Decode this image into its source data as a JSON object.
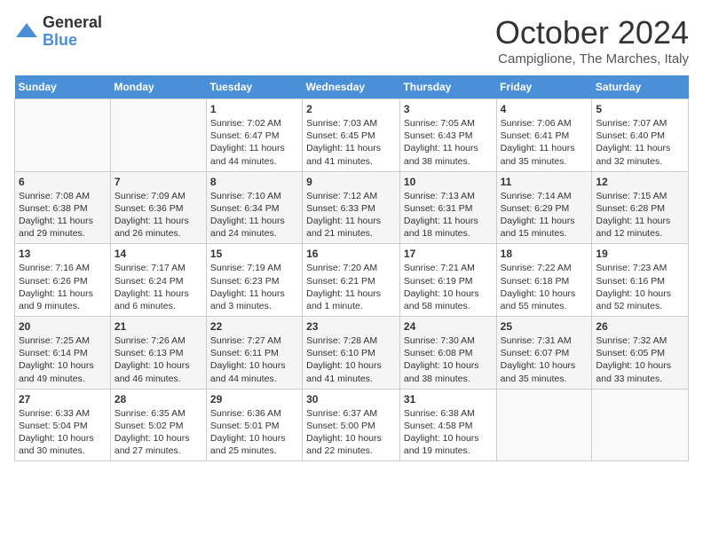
{
  "logo": {
    "general": "General",
    "blue": "Blue"
  },
  "title": "October 2024",
  "location": "Campiglione, The Marches, Italy",
  "headers": [
    "Sunday",
    "Monday",
    "Tuesday",
    "Wednesday",
    "Thursday",
    "Friday",
    "Saturday"
  ],
  "weeks": [
    [
      {
        "day": "",
        "sunrise": "",
        "sunset": "",
        "daylight": ""
      },
      {
        "day": "",
        "sunrise": "",
        "sunset": "",
        "daylight": ""
      },
      {
        "day": "1",
        "sunrise": "Sunrise: 7:02 AM",
        "sunset": "Sunset: 6:47 PM",
        "daylight": "Daylight: 11 hours and 44 minutes."
      },
      {
        "day": "2",
        "sunrise": "Sunrise: 7:03 AM",
        "sunset": "Sunset: 6:45 PM",
        "daylight": "Daylight: 11 hours and 41 minutes."
      },
      {
        "day": "3",
        "sunrise": "Sunrise: 7:05 AM",
        "sunset": "Sunset: 6:43 PM",
        "daylight": "Daylight: 11 hours and 38 minutes."
      },
      {
        "day": "4",
        "sunrise": "Sunrise: 7:06 AM",
        "sunset": "Sunset: 6:41 PM",
        "daylight": "Daylight: 11 hours and 35 minutes."
      },
      {
        "day": "5",
        "sunrise": "Sunrise: 7:07 AM",
        "sunset": "Sunset: 6:40 PM",
        "daylight": "Daylight: 11 hours and 32 minutes."
      }
    ],
    [
      {
        "day": "6",
        "sunrise": "Sunrise: 7:08 AM",
        "sunset": "Sunset: 6:38 PM",
        "daylight": "Daylight: 11 hours and 29 minutes."
      },
      {
        "day": "7",
        "sunrise": "Sunrise: 7:09 AM",
        "sunset": "Sunset: 6:36 PM",
        "daylight": "Daylight: 11 hours and 26 minutes."
      },
      {
        "day": "8",
        "sunrise": "Sunrise: 7:10 AM",
        "sunset": "Sunset: 6:34 PM",
        "daylight": "Daylight: 11 hours and 24 minutes."
      },
      {
        "day": "9",
        "sunrise": "Sunrise: 7:12 AM",
        "sunset": "Sunset: 6:33 PM",
        "daylight": "Daylight: 11 hours and 21 minutes."
      },
      {
        "day": "10",
        "sunrise": "Sunrise: 7:13 AM",
        "sunset": "Sunset: 6:31 PM",
        "daylight": "Daylight: 11 hours and 18 minutes."
      },
      {
        "day": "11",
        "sunrise": "Sunrise: 7:14 AM",
        "sunset": "Sunset: 6:29 PM",
        "daylight": "Daylight: 11 hours and 15 minutes."
      },
      {
        "day": "12",
        "sunrise": "Sunrise: 7:15 AM",
        "sunset": "Sunset: 6:28 PM",
        "daylight": "Daylight: 11 hours and 12 minutes."
      }
    ],
    [
      {
        "day": "13",
        "sunrise": "Sunrise: 7:16 AM",
        "sunset": "Sunset: 6:26 PM",
        "daylight": "Daylight: 11 hours and 9 minutes."
      },
      {
        "day": "14",
        "sunrise": "Sunrise: 7:17 AM",
        "sunset": "Sunset: 6:24 PM",
        "daylight": "Daylight: 11 hours and 6 minutes."
      },
      {
        "day": "15",
        "sunrise": "Sunrise: 7:19 AM",
        "sunset": "Sunset: 6:23 PM",
        "daylight": "Daylight: 11 hours and 3 minutes."
      },
      {
        "day": "16",
        "sunrise": "Sunrise: 7:20 AM",
        "sunset": "Sunset: 6:21 PM",
        "daylight": "Daylight: 11 hours and 1 minute."
      },
      {
        "day": "17",
        "sunrise": "Sunrise: 7:21 AM",
        "sunset": "Sunset: 6:19 PM",
        "daylight": "Daylight: 10 hours and 58 minutes."
      },
      {
        "day": "18",
        "sunrise": "Sunrise: 7:22 AM",
        "sunset": "Sunset: 6:18 PM",
        "daylight": "Daylight: 10 hours and 55 minutes."
      },
      {
        "day": "19",
        "sunrise": "Sunrise: 7:23 AM",
        "sunset": "Sunset: 6:16 PM",
        "daylight": "Daylight: 10 hours and 52 minutes."
      }
    ],
    [
      {
        "day": "20",
        "sunrise": "Sunrise: 7:25 AM",
        "sunset": "Sunset: 6:14 PM",
        "daylight": "Daylight: 10 hours and 49 minutes."
      },
      {
        "day": "21",
        "sunrise": "Sunrise: 7:26 AM",
        "sunset": "Sunset: 6:13 PM",
        "daylight": "Daylight: 10 hours and 46 minutes."
      },
      {
        "day": "22",
        "sunrise": "Sunrise: 7:27 AM",
        "sunset": "Sunset: 6:11 PM",
        "daylight": "Daylight: 10 hours and 44 minutes."
      },
      {
        "day": "23",
        "sunrise": "Sunrise: 7:28 AM",
        "sunset": "Sunset: 6:10 PM",
        "daylight": "Daylight: 10 hours and 41 minutes."
      },
      {
        "day": "24",
        "sunrise": "Sunrise: 7:30 AM",
        "sunset": "Sunset: 6:08 PM",
        "daylight": "Daylight: 10 hours and 38 minutes."
      },
      {
        "day": "25",
        "sunrise": "Sunrise: 7:31 AM",
        "sunset": "Sunset: 6:07 PM",
        "daylight": "Daylight: 10 hours and 35 minutes."
      },
      {
        "day": "26",
        "sunrise": "Sunrise: 7:32 AM",
        "sunset": "Sunset: 6:05 PM",
        "daylight": "Daylight: 10 hours and 33 minutes."
      }
    ],
    [
      {
        "day": "27",
        "sunrise": "Sunrise: 6:33 AM",
        "sunset": "Sunset: 5:04 PM",
        "daylight": "Daylight: 10 hours and 30 minutes."
      },
      {
        "day": "28",
        "sunrise": "Sunrise: 6:35 AM",
        "sunset": "Sunset: 5:02 PM",
        "daylight": "Daylight: 10 hours and 27 minutes."
      },
      {
        "day": "29",
        "sunrise": "Sunrise: 6:36 AM",
        "sunset": "Sunset: 5:01 PM",
        "daylight": "Daylight: 10 hours and 25 minutes."
      },
      {
        "day": "30",
        "sunrise": "Sunrise: 6:37 AM",
        "sunset": "Sunset: 5:00 PM",
        "daylight": "Daylight: 10 hours and 22 minutes."
      },
      {
        "day": "31",
        "sunrise": "Sunrise: 6:38 AM",
        "sunset": "Sunset: 4:58 PM",
        "daylight": "Daylight: 10 hours and 19 minutes."
      },
      {
        "day": "",
        "sunrise": "",
        "sunset": "",
        "daylight": ""
      },
      {
        "day": "",
        "sunrise": "",
        "sunset": "",
        "daylight": ""
      }
    ]
  ]
}
